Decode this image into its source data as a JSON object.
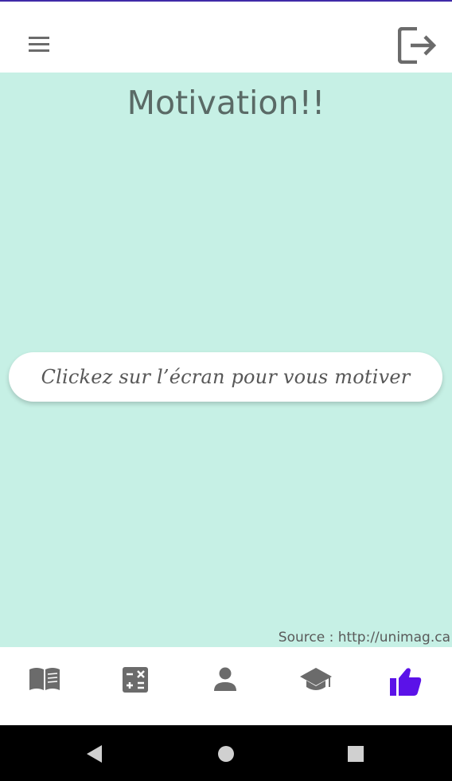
{
  "header": {
    "menu_icon": "hamburger-menu-icon",
    "logout_icon": "logout-icon"
  },
  "main": {
    "title": "Motivation!!",
    "motivate_prompt": "Clickez sur l’écran pour vous motiver",
    "source": "Source : http://unimag.ca"
  },
  "bottom_nav": {
    "items": [
      {
        "icon": "book-icon",
        "active": false
      },
      {
        "icon": "calculator-icon",
        "active": false
      },
      {
        "icon": "person-icon",
        "active": false
      },
      {
        "icon": "graduation-cap-icon",
        "active": false
      },
      {
        "icon": "thumbs-up-icon",
        "active": true
      }
    ]
  },
  "system_nav": {
    "items": [
      "back-icon",
      "home-icon",
      "recents-icon"
    ]
  },
  "colors": {
    "content_background": "#c6f0e5",
    "icon_inactive": "#6b6b6b",
    "icon_active": "#5b12e8",
    "title_text": "#5a6a66"
  }
}
